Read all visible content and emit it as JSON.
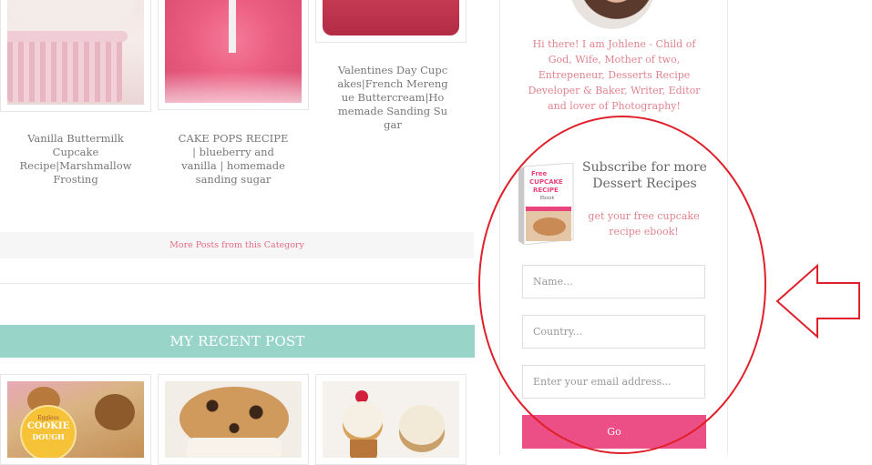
{
  "posts_top": [
    {
      "caption": "Vanilla Buttermilk Cupcake Recipe|Marshmallow Frosting"
    },
    {
      "caption": "CAKE POPS RECIPE | blueberry and vanilla | homemade sanding sugar"
    },
    {
      "caption": "Valentines Day Cupcakes|French Merengue Buttercream|Homemade Sanding Sugar"
    }
  ],
  "more_posts_label": "More Posts from this Category",
  "recent_heading": "MY RECENT POST",
  "recent_posts": [
    {
      "badge_top": "Eggless",
      "badge_line1": "COOKIE",
      "badge_line2": "DOUGH"
    },
    {},
    {}
  ],
  "sidebar": {
    "bio": "Hi there! I am Johlene - Child of God, Wife, Mother of two, Entrepeneur, Desserts Recipe Developer & Baker, Writer, Editor and lover of Photography!",
    "subscribe_title": "Subscribe for more Dessert Recipes",
    "subscribe_sub": "get your free cupcake recipe ebook!",
    "ebook": {
      "line1": "Free",
      "line2": "CUPCAKE",
      "line3": "RECIPE",
      "line4": "Ebook"
    },
    "fields": {
      "name_placeholder": "Name...",
      "country_placeholder": "Country...",
      "email_placeholder": "Enter your email address..."
    },
    "go_label": "Go"
  },
  "colors": {
    "accent_teal": "#98d5c8",
    "accent_pink": "#ec4f86",
    "annotation_red": "#e0202a"
  }
}
